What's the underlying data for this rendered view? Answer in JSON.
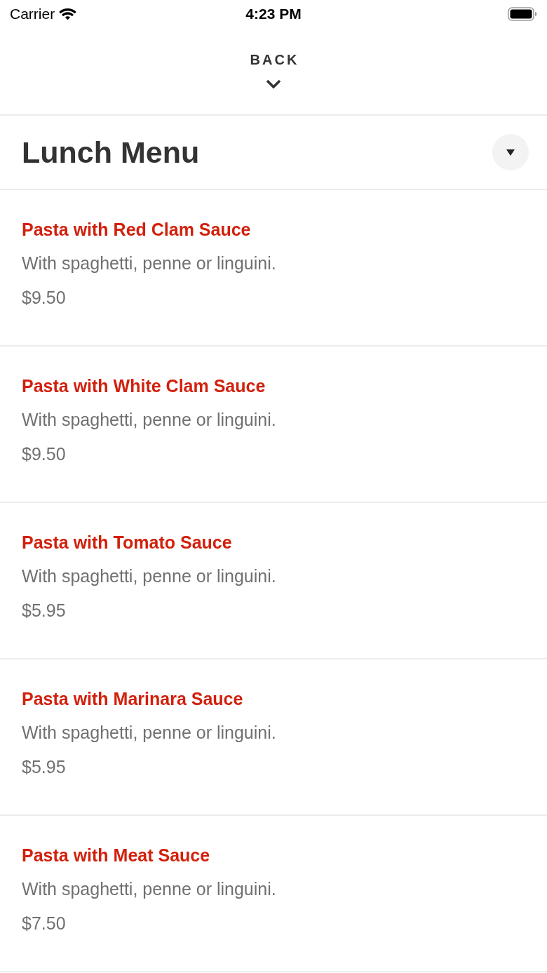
{
  "status_bar": {
    "carrier": "Carrier",
    "time": "4:23 PM"
  },
  "header": {
    "back_label": "BACK"
  },
  "menu": {
    "title": "Lunch Menu"
  },
  "items": [
    {
      "name": "Pasta with Red Clam Sauce",
      "description": "With spaghetti, penne or linguini.",
      "price": "$9.50"
    },
    {
      "name": "Pasta with White Clam Sauce",
      "description": "With spaghetti, penne or linguini.",
      "price": "$9.50"
    },
    {
      "name": "Pasta with Tomato Sauce",
      "description": "With spaghetti, penne or linguini.",
      "price": "$5.95"
    },
    {
      "name": "Pasta with Marinara Sauce",
      "description": "With spaghetti, penne or linguini.",
      "price": "$5.95"
    },
    {
      "name": "Pasta with Meat Sauce",
      "description": "With spaghetti, penne or linguini.",
      "price": "$7.50"
    }
  ]
}
